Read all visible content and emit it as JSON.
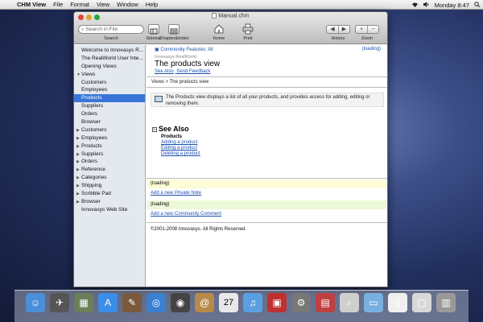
{
  "menubar": {
    "apple": "",
    "items": [
      "CHM View",
      "File",
      "Format",
      "View",
      "Window",
      "Help"
    ],
    "clock": "Monday 8:47",
    "status_icons": [
      "wifi-icon",
      "volume-icon",
      "spotlight-icon"
    ]
  },
  "window": {
    "title": "Manual.chm",
    "search_placeholder": "Search in File",
    "search_label": "Search",
    "toolbar_labels": {
      "sidebar": "Sidebar",
      "chapter": "Chapter&Index",
      "home": "Home",
      "print": "Print",
      "history": "History",
      "zoom": "Zoom"
    },
    "history_back": "◀",
    "history_fwd": "▶",
    "zoom_in": "+",
    "zoom_out": "−"
  },
  "sidebar": {
    "items": [
      {
        "label": "Welcome to Innovasys R...",
        "tri": ""
      },
      {
        "label": "The RealWorld User Inte...",
        "tri": ""
      },
      {
        "label": "Opening Views",
        "tri": ""
      },
      {
        "label": "Views",
        "tri": "▼"
      },
      {
        "label": "Customers",
        "tri": ""
      },
      {
        "label": "Employees",
        "tri": ""
      },
      {
        "label": "Products",
        "tri": "",
        "selected": true
      },
      {
        "label": "Suppliers",
        "tri": ""
      },
      {
        "label": "Orders",
        "tri": ""
      },
      {
        "label": "Browser",
        "tri": ""
      },
      {
        "label": "Customers",
        "tri": "▶"
      },
      {
        "label": "Employees",
        "tri": "▶"
      },
      {
        "label": "Products",
        "tri": "▶"
      },
      {
        "label": "Suppliers",
        "tri": "▶"
      },
      {
        "label": "Orders",
        "tri": "▶"
      },
      {
        "label": "Reference",
        "tri": "▶"
      },
      {
        "label": "Categories",
        "tri": "▶"
      },
      {
        "label": "Shipping",
        "tri": "▶"
      },
      {
        "label": "Scribble Pad",
        "tri": "▶"
      },
      {
        "label": "Browser",
        "tri": "▶"
      },
      {
        "label": "Innovasys Web Site",
        "tri": ""
      }
    ]
  },
  "content": {
    "community_features": "Community Features: All",
    "loading": "(loading)",
    "brand": "Innovasys RealWorld",
    "title": "The products view",
    "see_also_link": "See Also",
    "send_feedback_link": "Send Feedback",
    "breadcrumb": "Views > The products view",
    "description": "The Products view displays a list of all your products, and provides access for adding, editing or removing them.",
    "see_also_heading": "See Also",
    "see_also_toggle": "−",
    "products_heading": "Products",
    "product_links": [
      "Adding a product",
      "Editing a product",
      "Deleting a product"
    ],
    "private_note_loading": "(loading)",
    "add_private_note": "Add a new Private Note",
    "community_loading": "(loading)",
    "add_community_comment": "Add a new Community Comment",
    "copyright": "©2001-2008 Innovasys. All Rights Reserved."
  },
  "dock": {
    "icons": [
      "finder-icon",
      "launchpad-icon",
      "mission-control-icon",
      "app-store-icon",
      "preview-icon",
      "safari-icon",
      "facetime-icon",
      "address-book-icon",
      "calendar-icon",
      "itunes-icon",
      "photo-booth-icon",
      "system-preferences-icon",
      "chm-view-icon",
      "preview-magnifier-icon",
      "folder-icon",
      "document-icon",
      "window-icon",
      "trash-icon"
    ],
    "calendar_day": "27"
  }
}
